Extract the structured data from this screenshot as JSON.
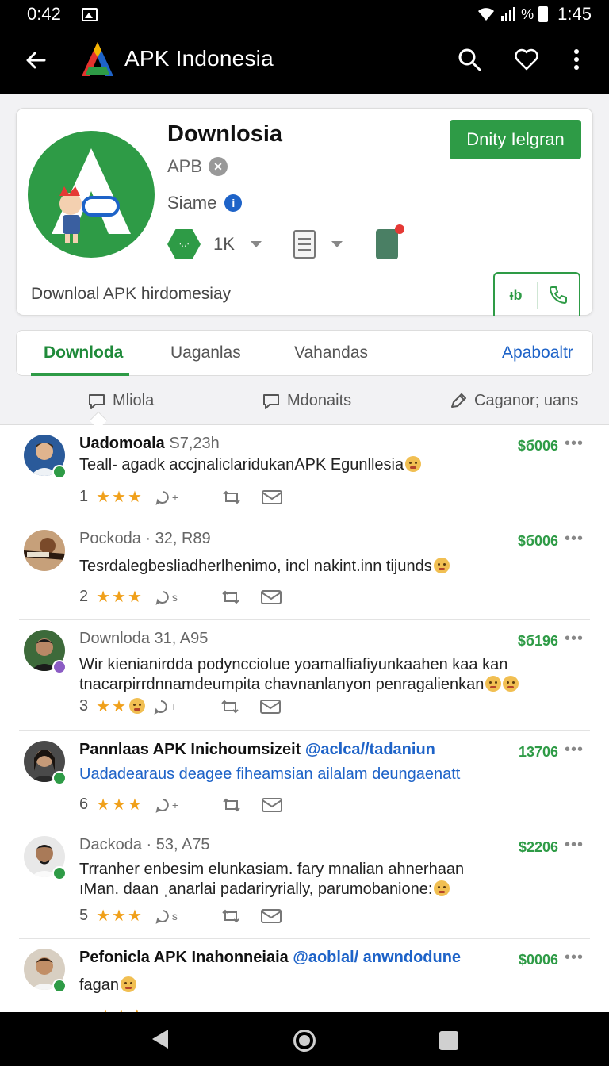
{
  "status_bar": {
    "time_left": "0:42",
    "battery_text": "%",
    "time_right": "1:45"
  },
  "app_bar": {
    "title": "APK Indonesia"
  },
  "app_card": {
    "name": "Downlosia",
    "developer": "APB",
    "author": "Siame",
    "install_count": "1K",
    "tagline": "Downloal APK hirdomesiay",
    "install_button": "Dnity Ielgran",
    "action_label": "ᵻb"
  },
  "tabs": [
    {
      "label": "Downloda"
    },
    {
      "label": "Uaganlas"
    },
    {
      "label": "Vahandas"
    },
    {
      "label": "Apaboaltr"
    }
  ],
  "subtabs": [
    {
      "label": "Mliola"
    },
    {
      "label": "Mdonaits"
    },
    {
      "label": "Caganor; uans"
    }
  ],
  "posts": [
    {
      "name": "Uadomoala",
      "meta": "S7,23h",
      "price": "$б006",
      "body": [
        "Teall- agadk accjnaliclaridukanAPK Egunllesia"
      ],
      "rating": "1",
      "comments": "+"
    },
    {
      "name": "Pockoda",
      "meta": "· 32, R89",
      "price": "$б006",
      "body": [
        "Tesrdalegbesliadherlhenimo, incl nakint.inn tijunds"
      ],
      "rating": "2",
      "comments": "s"
    },
    {
      "name": "Downloda",
      "meta": "31, A95",
      "price": "$б196",
      "body": [
        "Wir kienianirdda podyncciolue yoamalfiafiyunkaahen kaa  kan",
        "tnacarpirrdnnamdeumpita chavnanlanyon penragalienkan"
      ],
      "rating": "3",
      "comments": "+"
    },
    {
      "name": "Pannlaas APK Inichoumsizeit",
      "mention": "@aclca//tadaniun",
      "price": "13706",
      "body": [
        "Uadadearaus deagee fiheamsian ailalam deungaenatt"
      ],
      "rating": "6",
      "comments": "+"
    },
    {
      "name": "Dackoda",
      "meta": "· 53, A75",
      "price": "$2206",
      "body": [
        "Trranher enbesim elunkasiam. fary mnalian ahnerhaan",
        "ıMan. daan ˌanarlai padariryrially, parumobanione:"
      ],
      "rating": "5",
      "comments": "s"
    },
    {
      "name": "Pefonicla APK Inahonneiaia",
      "mention": "@aoblal/ anwndodune",
      "price": "$0006",
      "body": [
        "fagan"
      ],
      "rating": "",
      "comments": ""
    }
  ],
  "colors": {
    "accent": "#2e9b46",
    "link": "#1e63c8",
    "star": "#f0a01a"
  }
}
